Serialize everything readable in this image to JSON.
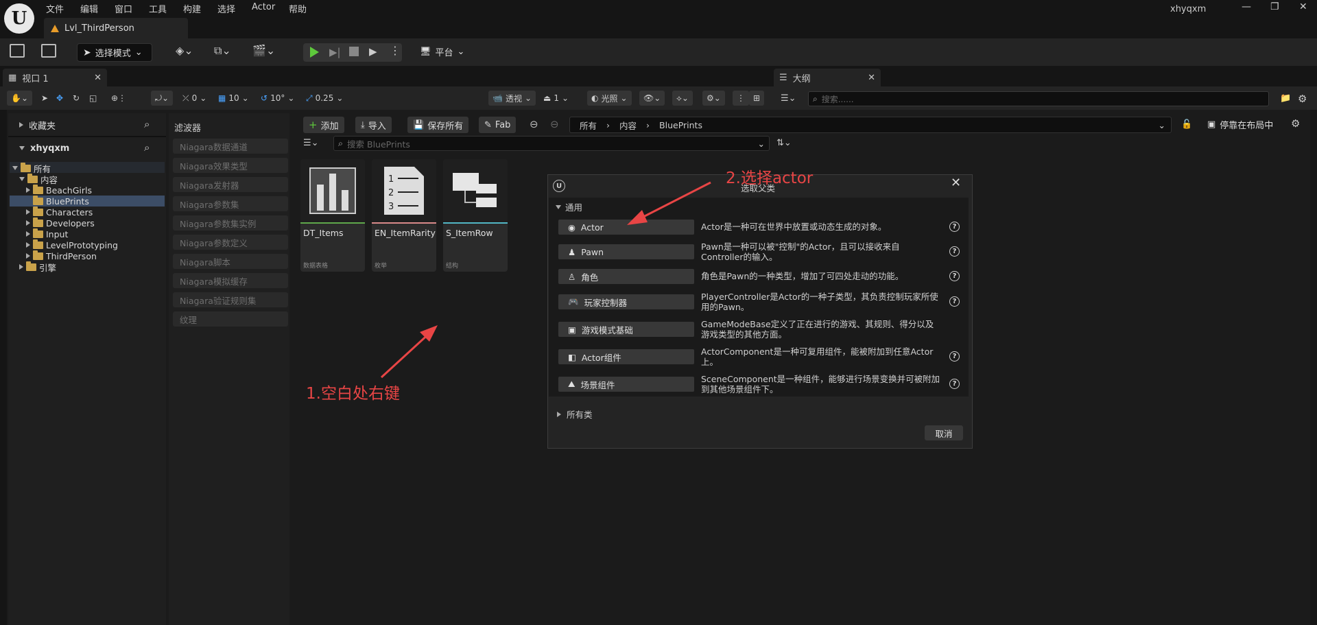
{
  "app": {
    "menu": [
      "文件",
      "编辑",
      "窗口",
      "工具",
      "构建",
      "选择",
      "Actor",
      "帮助"
    ],
    "level_tab": "Lvl_ThirdPerson",
    "username": "xhyqxm"
  },
  "toolbar": {
    "mode_label": "选择模式",
    "platform_label": "平台"
  },
  "viewport": {
    "tab_label": "视口 1",
    "snap_rotate": "0",
    "grid_size": "10",
    "rotation_snap": "10°",
    "scale_snap": "0.25",
    "perspective": "透视",
    "lit": "光照",
    "camera_speed": "1"
  },
  "outliner": {
    "tab_label": "大纲",
    "search_placeholder": "搜索......",
    "dock_label": "停靠在布局中"
  },
  "content_browser": {
    "favorites": "收藏夹",
    "root": "xhyqxm",
    "tree": [
      {
        "label": "所有",
        "depth": 0,
        "expanded": true
      },
      {
        "label": "内容",
        "depth": 1,
        "expanded": true
      },
      {
        "label": "BeachGirls",
        "depth": 2,
        "expanded": false
      },
      {
        "label": "BluePrints",
        "depth": 2,
        "selected": true
      },
      {
        "label": "Characters",
        "depth": 2,
        "expanded": false
      },
      {
        "label": "Developers",
        "depth": 2,
        "expanded": false
      },
      {
        "label": "Input",
        "depth": 2,
        "expanded": false
      },
      {
        "label": "LevelPrototyping",
        "depth": 2,
        "expanded": false
      },
      {
        "label": "ThirdPerson",
        "depth": 2,
        "expanded": false
      },
      {
        "label": "引擎",
        "depth": 0,
        "expanded": false
      }
    ],
    "filters_title": "滤波器",
    "filters": [
      "Niagara数据通道",
      "Niagara效果类型",
      "Niagara发射器",
      "Niagara参数集",
      "Niagara参数集实例",
      "Niagara参数定义",
      "Niagara脚本",
      "Niagara模拟缓存",
      "Niagara验证规则集",
      "纹理"
    ],
    "add": "添加",
    "import": "导入",
    "save_all": "保存所有",
    "fab": "Fab",
    "breadcrumb": [
      "所有",
      "内容",
      "BluePrints"
    ],
    "search_placeholder": "搜索 BluePrints",
    "assets": [
      {
        "name": "DT_Items",
        "type": "数据表格",
        "color": "#5fa84b"
      },
      {
        "name": "EN_ItemRarity",
        "type": "枚举",
        "color": "#d98a8a"
      },
      {
        "name": "S_ItemRow",
        "type": "结构",
        "color": "#52b7c6"
      }
    ]
  },
  "dialog": {
    "title": "选取父类",
    "section": "通用",
    "classes": [
      {
        "label": "Actor",
        "desc": "Actor是一种可在世界中放置或动态生成的对象。",
        "icon": "actor-icon"
      },
      {
        "label": "Pawn",
        "desc": "Pawn是一种可以被\"控制\"的Actor，且可以接收来自Controller的输入。",
        "icon": "pawn-icon"
      },
      {
        "label": "角色",
        "desc": "角色是Pawn的一种类型，增加了可四处走动的功能。",
        "icon": "character-icon"
      },
      {
        "label": "玩家控制器",
        "desc": "PlayerController是Actor的一种子类型，其负责控制玩家所使用的Pawn。",
        "icon": "gamepad-icon"
      },
      {
        "label": "游戏模式基础",
        "desc": "GameModeBase定义了正在进行的游戏、其规则、得分以及游戏类型的其他方面。",
        "icon": "gamemode-icon"
      },
      {
        "label": "Actor组件",
        "desc": "ActorComponent是一种可复用组件，能被附加到任意Actor上。",
        "icon": "component-icon"
      },
      {
        "label": "场景组件",
        "desc": "SceneComponent是一种组件，能够进行场景变换并可被附加到其他场景组件下。",
        "icon": "scene-icon"
      }
    ],
    "all_classes": "所有类",
    "cancel": "取消"
  },
  "annotations": {
    "step1": "1.空白处右键",
    "step2": "2.选择actor",
    "color": "#e84545"
  }
}
